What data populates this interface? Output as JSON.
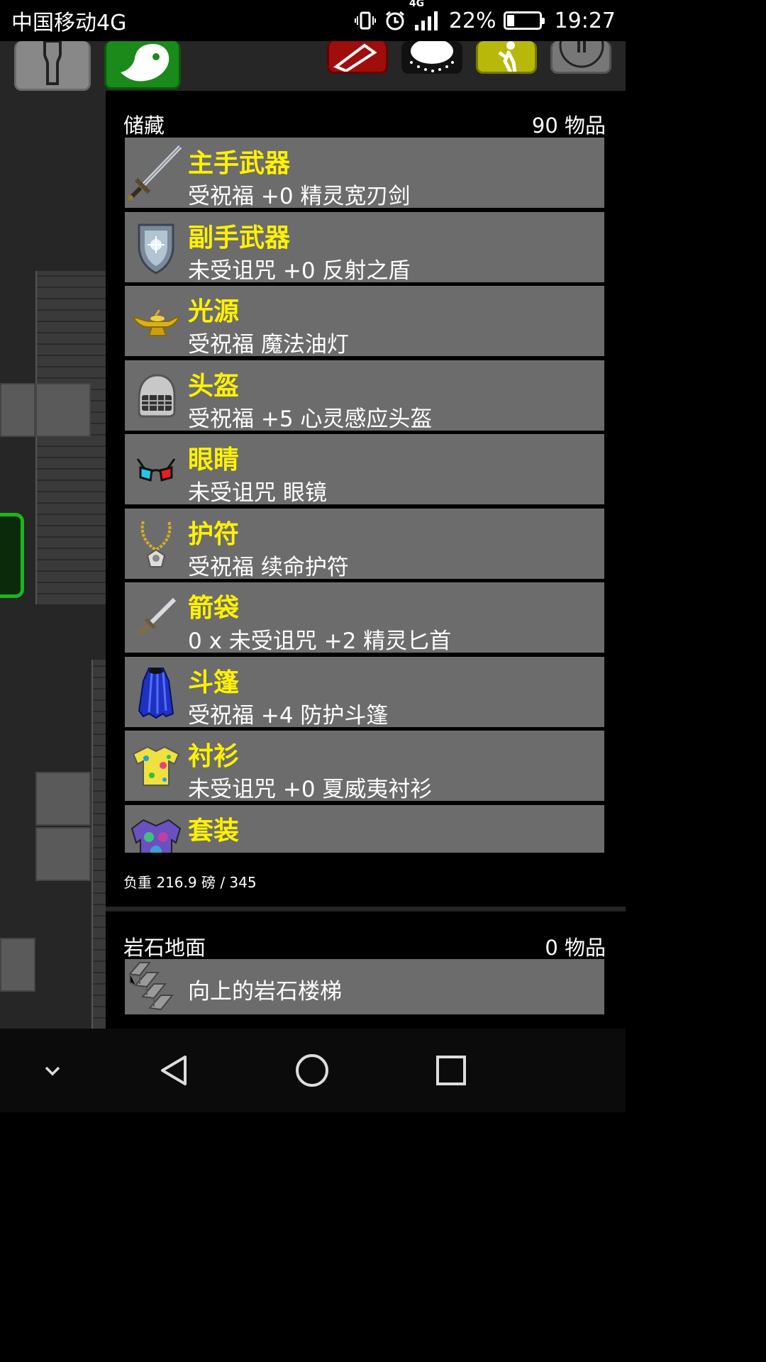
{
  "status_bar": {
    "carrier": "中国移动4G",
    "network_badge": "4G",
    "battery": "22%",
    "battery_level": 0.22,
    "time": "19:27"
  },
  "toolbar": {
    "buttons": [
      {
        "icon": "person-icon"
      },
      {
        "icon": "ghost-icon"
      },
      {
        "icon": "red-action-icon"
      },
      {
        "icon": "spark-icon"
      },
      {
        "icon": "walk-icon"
      },
      {
        "icon": "pause-icon"
      }
    ]
  },
  "inventory": {
    "title": "储藏",
    "count": "90 物品",
    "items": [
      {
        "slot": "主手武器",
        "desc": "受祝福 +0 精灵宽刃剑",
        "icon": "sword-icon"
      },
      {
        "slot": "副手武器",
        "desc": "未受诅咒 +0 反射之盾",
        "icon": "shield-icon"
      },
      {
        "slot": "光源",
        "desc": "受祝福 魔法油灯",
        "icon": "lamp-icon"
      },
      {
        "slot": "头盔",
        "desc": "受祝福 +5 心灵感应头盔",
        "icon": "helmet-icon"
      },
      {
        "slot": "眼睛",
        "desc": "未受诅咒 眼镜",
        "icon": "glasses-icon"
      },
      {
        "slot": "护符",
        "desc": "受祝福 续命护符",
        "icon": "amulet-icon"
      },
      {
        "slot": "箭袋",
        "desc": "0 x 未受诅咒 +2 精灵匕首",
        "icon": "dagger-icon"
      },
      {
        "slot": "斗篷",
        "desc": "受祝福 +4 防护斗篷",
        "icon": "cloak-icon"
      },
      {
        "slot": "衬衫",
        "desc": "未受诅咒 +0 夏威夷衬衫",
        "icon": "shirt-icon"
      },
      {
        "slot": "套装",
        "desc": "",
        "icon": "armor-icon"
      }
    ],
    "weight": "负重 216.9 磅 / 345"
  },
  "floor": {
    "title": "岩石地面",
    "count": "0 物品",
    "items": [
      {
        "desc": "向上的岩石楼梯",
        "icon": "stairs-icon"
      }
    ]
  },
  "nav": {
    "buttons": [
      {
        "icon": "chevron-down-icon"
      },
      {
        "icon": "back-icon"
      },
      {
        "icon": "home-icon"
      },
      {
        "icon": "recents-icon"
      }
    ]
  }
}
